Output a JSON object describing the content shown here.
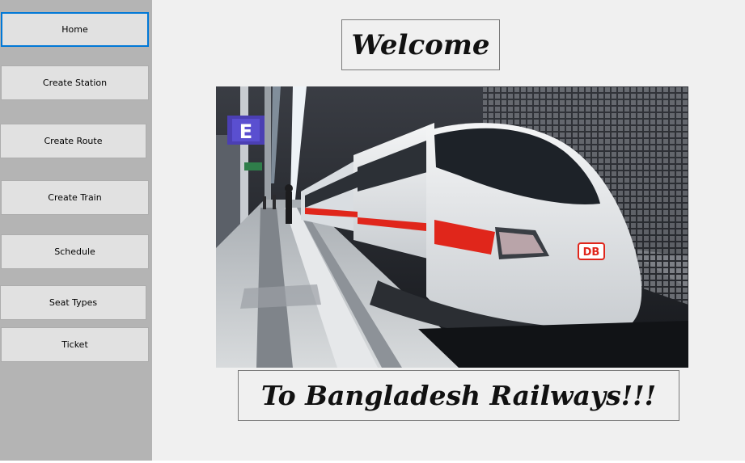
{
  "sidebar": {
    "items": [
      {
        "label": "Home",
        "active": true
      },
      {
        "label": "Create Station"
      },
      {
        "label": "Create Route"
      },
      {
        "label": "Create Train"
      },
      {
        "label": "Schedule"
      },
      {
        "label": "Seat Types"
      },
      {
        "label": "Ticket"
      }
    ]
  },
  "main": {
    "welcome_text": "Welcome",
    "tagline_text": "To Bangladesh Railways!!!",
    "photo": {
      "platform_sign": "E",
      "train_logo": "DB"
    }
  },
  "colors": {
    "sidebar_bg": "#b4b4b4",
    "button_bg": "#e1e1e1",
    "active_border": "#0078d7",
    "window_bg": "#f0f0f0",
    "train_stripe": "#e0261b"
  }
}
